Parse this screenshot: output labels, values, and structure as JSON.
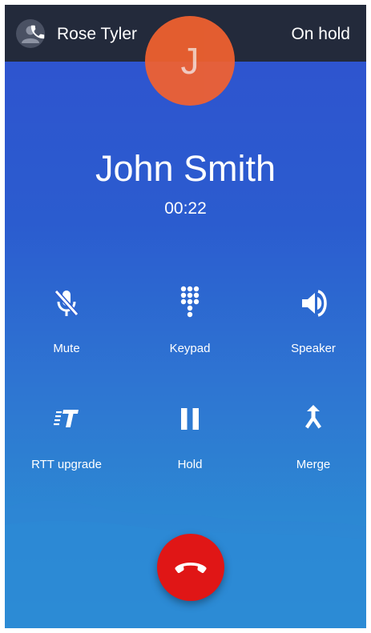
{
  "hold_bar": {
    "name": "Rose Tyler",
    "status": "On hold",
    "avatar_icon": "person-icon",
    "phone_icon": "phone-icon"
  },
  "contact": {
    "initial": "J",
    "name": "John Smith",
    "timer": "00:22"
  },
  "actions": [
    {
      "label": "Mute",
      "icon": "mic-off-icon"
    },
    {
      "label": "Keypad",
      "icon": "dialpad-icon"
    },
    {
      "label": "Speaker",
      "icon": "speaker-icon"
    },
    {
      "label": "RTT upgrade",
      "icon": "rtt-icon"
    },
    {
      "label": "Hold",
      "icon": "pause-icon"
    },
    {
      "label": "Merge",
      "icon": "merge-icon"
    }
  ],
  "end_call": {
    "icon": "end-call-icon"
  },
  "colors": {
    "hold_bar": "#232a3b",
    "avatar": "#f2612f",
    "end_call": "#e01616",
    "background_top": "#2f52cf",
    "background_bottom": "#2a8fd3"
  }
}
